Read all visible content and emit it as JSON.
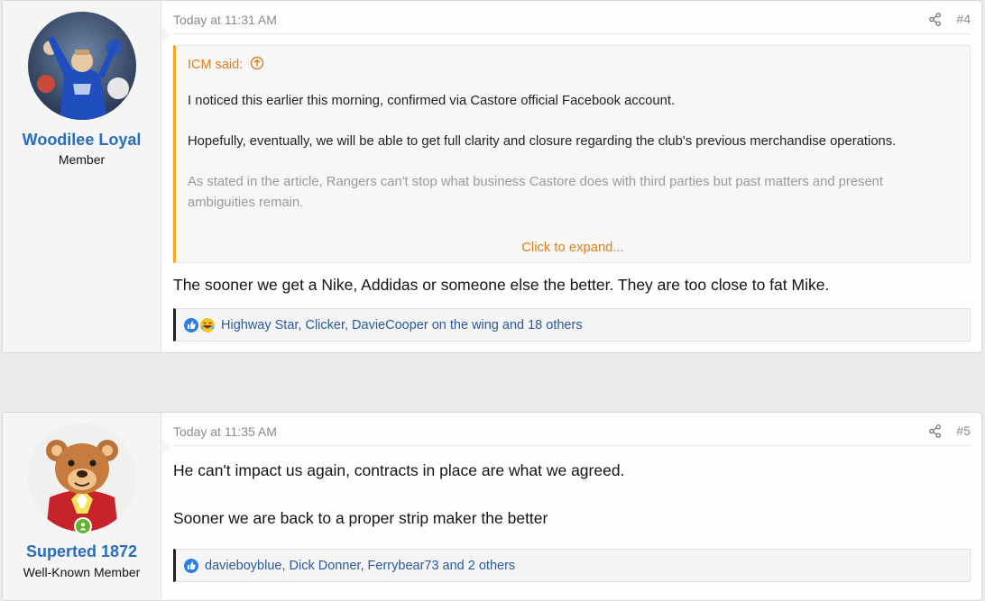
{
  "posts": [
    {
      "username": "Woodilee Loyal",
      "user_title": "Member",
      "date": "Today at 11:31 AM",
      "post_number": "#4",
      "quote": {
        "author": "ICM said:",
        "paragraphs": [
          "I noticed this earlier this morning, confirmed via Castore official Facebook account.",
          "Hopefully, eventually, we will be able to get full clarity and closure regarding the club's previous merchandise operations.",
          "As stated in the article, Rangers can't stop what business Castore does with third parties but past matters and present ambiguities remain."
        ],
        "expand_label": "Click to expand..."
      },
      "message": [
        "The sooner we get a Nike, Addidas or someone else the better. They are too close to fat Mike."
      ],
      "reactions": "Highway Star, Clicker, DavieCooper on the wing and 18 others"
    },
    {
      "username": "Superted 1872",
      "user_title": "Well-Known Member",
      "date": "Today at 11:35 AM",
      "post_number": "#5",
      "message": [
        "He can't impact us again, contracts in place are what we agreed.",
        "Sooner we are back to a proper strip maker the better"
      ],
      "reactions": "davieboyblue, Dick Donner, Ferrybear73 and 2 others"
    }
  ],
  "colors": {
    "username": "#2a6dbf",
    "quote_accent": "#f5a623",
    "reaction_text": "#2a5a9a",
    "online": "#63b32e"
  }
}
